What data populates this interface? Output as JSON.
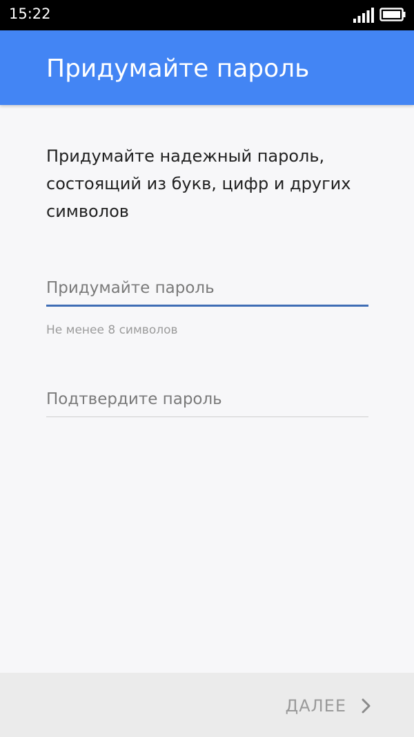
{
  "status_bar": {
    "time": "15:22",
    "signal_icon": "signal-icon",
    "battery_icon": "battery-icon"
  },
  "app_bar": {
    "title": "Придумайте пароль",
    "color": "#4385f4"
  },
  "content": {
    "description": "Придумайте надежный пароль, состоящий из букв, цифр и других символов",
    "password_field": {
      "placeholder": "Придумайте пароль",
      "value": "",
      "helper": "Не менее 8 символов"
    },
    "confirm_field": {
      "placeholder": "Подтвердите пароль",
      "value": ""
    }
  },
  "footer": {
    "next_label": "ДАЛЕЕ",
    "next_icon": "chevron-right-icon"
  }
}
